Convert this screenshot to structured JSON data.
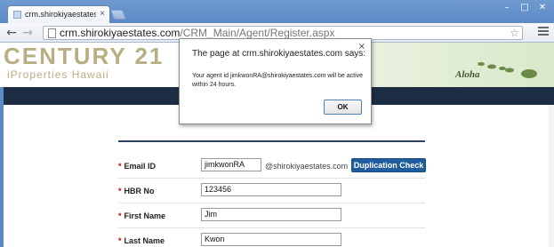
{
  "browser": {
    "tab_title": "crm.shirokiyaestates.com",
    "tab_close": "×",
    "url_host": "crm.shirokiyaestates.com",
    "url_path": "/CRM_Main/Agent/Register.aspx",
    "back_glyph": "←",
    "forward_glyph": "→",
    "reload_glyph": "C",
    "star_glyph": "☆",
    "window_controls": [
      "–",
      "□",
      "✕"
    ]
  },
  "site": {
    "logo_text": "CENTURY 21",
    "logo_subtitle": "iProperties Hawaii",
    "aloha": "Aloha"
  },
  "form": {
    "fields": [
      {
        "label": "Email ID",
        "value": "jimkwonRA",
        "suffix": "@shirokiyaestates.com"
      },
      {
        "label": "HBR No",
        "value": "123456"
      },
      {
        "label": "First Name",
        "value": "Jim"
      },
      {
        "label": "Last Name",
        "value": "Kwon"
      }
    ],
    "required_mark": "*",
    "duplication_check_label": "Duplication Check"
  },
  "dialog": {
    "title": "The page at crm.shirokiyaestates.com says:",
    "close_glyph": "×",
    "message": "Your agent id  jimkwonRA@shirokiyaestates.com  will be active within 24 hours.",
    "ok_label": "OK"
  },
  "colors": {
    "chrome_blue": "#5b8ac4",
    "header_dark": "#1d2e44",
    "button_blue": "#1f5d9c",
    "required_red": "#cc0000"
  }
}
